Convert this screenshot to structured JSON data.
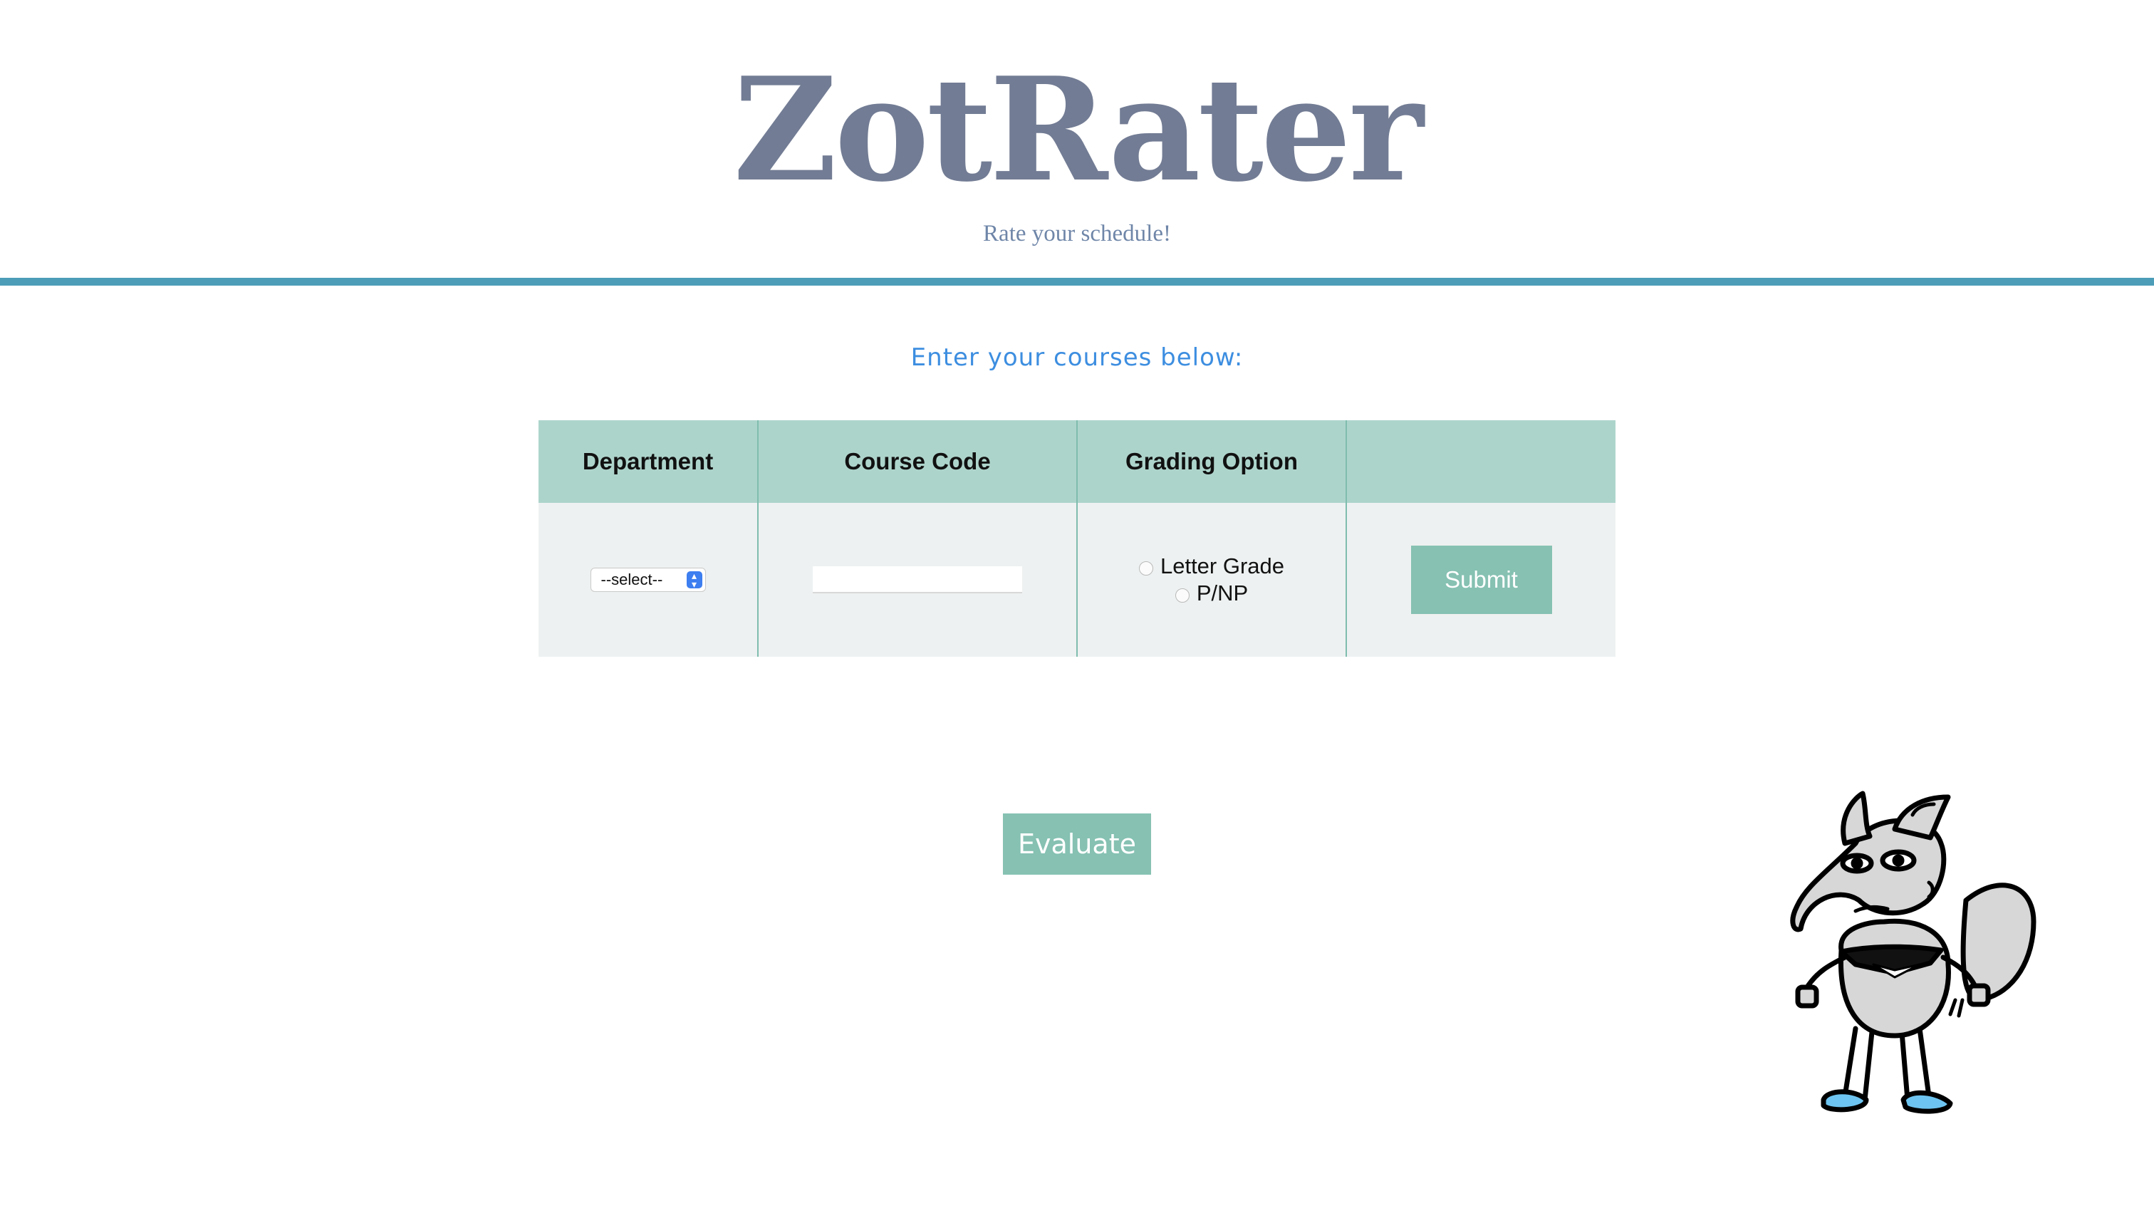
{
  "header": {
    "title": "ZotRater",
    "subtitle": "Rate your schedule!"
  },
  "main": {
    "prompt": "Enter your courses below:",
    "table": {
      "columns": [
        "Department",
        "Course Code",
        "Grading Option",
        ""
      ],
      "department_select": {
        "selected": "--select--"
      },
      "course_code": {
        "value": "",
        "placeholder": ""
      },
      "grading_options": [
        "Letter Grade",
        "P/NP"
      ],
      "submit_label": "Submit"
    },
    "evaluate_label": "Evaluate"
  },
  "mascot": {
    "icon": "anteater-mascot-icon"
  },
  "colors": {
    "title": "#727c94",
    "divider": "#4d9db8",
    "prompt": "#3d8ee0",
    "table_header": "#add4cb",
    "table_body": "#eef1f1",
    "button": "#86c1b2"
  }
}
